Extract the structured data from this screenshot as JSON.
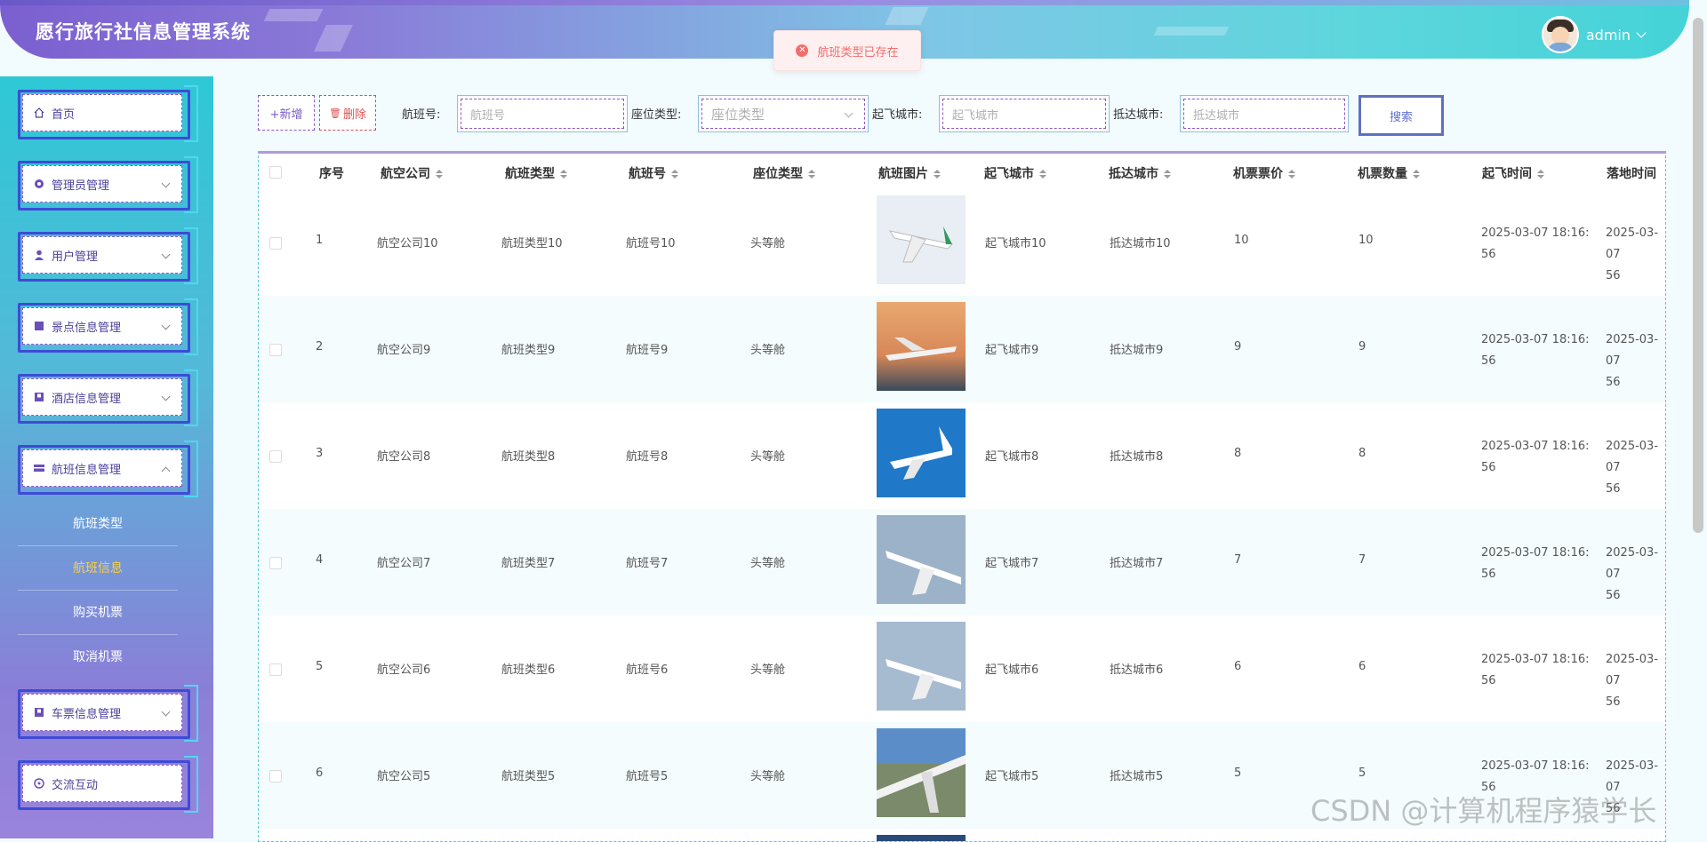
{
  "header": {
    "title": "愿行旅行社信息管理系统",
    "username": "admin"
  },
  "toast": {
    "message": "航班类型已存在"
  },
  "sidebar": {
    "items": [
      {
        "label": "首页",
        "icon": "home-icon"
      },
      {
        "label": "管理员管理",
        "icon": "admin-icon"
      },
      {
        "label": "用户管理",
        "icon": "user-icon"
      },
      {
        "label": "景点信息管理",
        "icon": "scenic-icon"
      },
      {
        "label": "酒店信息管理",
        "icon": "hotel-icon"
      },
      {
        "label": "航班信息管理",
        "icon": "flight-icon"
      },
      {
        "label": "车票信息管理",
        "icon": "ticket-icon"
      },
      {
        "label": "交流互动",
        "icon": "chat-icon"
      }
    ],
    "subitems": [
      {
        "label": "航班类型"
      },
      {
        "label": "航班信息"
      },
      {
        "label": "购买机票"
      },
      {
        "label": "取消机票"
      }
    ]
  },
  "toolbar": {
    "add_label": "+新增",
    "delete_label": "删除",
    "flight_no_label": "航班号:",
    "flight_no_placeholder": "航班号",
    "seat_label": "座位类型:",
    "seat_placeholder": "座位类型",
    "from_label": "起飞城市:",
    "from_placeholder": "起飞城市",
    "to_label": "抵达城市:",
    "to_placeholder": "抵达城市",
    "search_label": "搜索"
  },
  "table": {
    "columns": [
      "序号",
      "航空公司",
      "航班类型",
      "航班号",
      "座位类型",
      "航班图片",
      "起飞城市",
      "抵达城市",
      "机票票价",
      "机票数量",
      "起飞时间",
      "落地时间"
    ],
    "rows": [
      {
        "no": "1",
        "airline": "航空公司10",
        "type": "航班类型10",
        "flight": "航班号10",
        "seat": "头等舱",
        "from": "起飞城市10",
        "to": "抵达城市10",
        "price": "10",
        "qty": "10",
        "dep_a": "2025-03-07 18:16:",
        "dep_b": "56",
        "arr_a": "2025-03-07",
        "arr_b": "56"
      },
      {
        "no": "2",
        "airline": "航空公司9",
        "type": "航班类型9",
        "flight": "航班号9",
        "seat": "头等舱",
        "from": "起飞城市9",
        "to": "抵达城市9",
        "price": "9",
        "qty": "9",
        "dep_a": "2025-03-07 18:16:",
        "dep_b": "56",
        "arr_a": "2025-03-07",
        "arr_b": "56"
      },
      {
        "no": "3",
        "airline": "航空公司8",
        "type": "航班类型8",
        "flight": "航班号8",
        "seat": "头等舱",
        "from": "起飞城市8",
        "to": "抵达城市8",
        "price": "8",
        "qty": "8",
        "dep_a": "2025-03-07 18:16:",
        "dep_b": "56",
        "arr_a": "2025-03-07",
        "arr_b": "56"
      },
      {
        "no": "4",
        "airline": "航空公司7",
        "type": "航班类型7",
        "flight": "航班号7",
        "seat": "头等舱",
        "from": "起飞城市7",
        "to": "抵达城市7",
        "price": "7",
        "qty": "7",
        "dep_a": "2025-03-07 18:16:",
        "dep_b": "56",
        "arr_a": "2025-03-07",
        "arr_b": "56"
      },
      {
        "no": "5",
        "airline": "航空公司6",
        "type": "航班类型6",
        "flight": "航班号6",
        "seat": "头等舱",
        "from": "起飞城市6",
        "to": "抵达城市6",
        "price": "6",
        "qty": "6",
        "dep_a": "2025-03-07 18:16:",
        "dep_b": "56",
        "arr_a": "2025-03-07",
        "arr_b": "56"
      },
      {
        "no": "6",
        "airline": "航空公司5",
        "type": "航班类型5",
        "flight": "航班号5",
        "seat": "头等舱",
        "from": "起飞城市5",
        "to": "抵达城市5",
        "price": "5",
        "qty": "5",
        "dep_a": "2025-03-07 18:16:",
        "dep_b": "56",
        "arr_a": "2025-03-07",
        "arr_b": "56"
      }
    ]
  },
  "watermark": "CSDN @计算机程序猿学长"
}
